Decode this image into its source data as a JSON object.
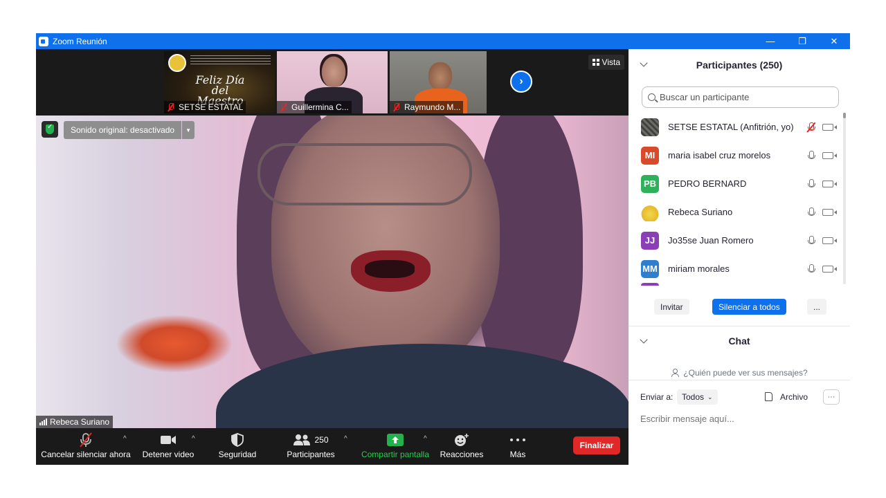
{
  "window": {
    "title": "Zoom Reunión",
    "minimize": "—",
    "restore": "❐",
    "close": "✕"
  },
  "thumbnails": [
    {
      "name": "SETSE ESTATAL",
      "poster_title": "Feliz Día del Maestro"
    },
    {
      "name": "Guillermina C..."
    },
    {
      "name": "Raymundo M..."
    }
  ],
  "view_button": "Vista",
  "main_video": {
    "sound_label": "Sonido original: desactivado",
    "speaker_name": "Rebeca Suriano"
  },
  "toolbar": {
    "mute": "Cancelar silenciar ahora",
    "video": "Detener video",
    "security": "Seguridad",
    "participants": "Participantes",
    "participants_count": "250",
    "share": "Compartir pantalla",
    "reactions": "Reacciones",
    "more": "Más",
    "end": "Finalizar",
    "share_color": "#22b14c",
    "end_color": "#e02828"
  },
  "participants_panel": {
    "title": "Participantes (250)",
    "search_placeholder": "Buscar un participante",
    "items": [
      {
        "initials": "",
        "name": "SETSE ESTATAL (Anfitrión, yo)",
        "color": "#5a5a5a",
        "mic": "off"
      },
      {
        "initials": "MI",
        "name": "maria isabel cruz morelos",
        "color": "#d94a2b",
        "mic": "on"
      },
      {
        "initials": "PB",
        "name": "PEDRO BERNARD",
        "color": "#2fb05a",
        "mic": "on"
      },
      {
        "initials": "",
        "name": "Rebeca Suriano",
        "color": "#f1d348",
        "mic": "on"
      },
      {
        "initials": "JJ",
        "name": "Jo35se Juan Romero",
        "color": "#8b3fb5",
        "mic": "on"
      },
      {
        "initials": "MM",
        "name": "miriam morales",
        "color": "#2f7fd1",
        "mic": "on"
      }
    ],
    "invite": "Invitar",
    "mute_all": "Silenciar a todos",
    "more": "..."
  },
  "chat_panel": {
    "title": "Chat",
    "who_can_see": "¿Quién puede ver sus mensajes?",
    "send_to_label": "Enviar a:",
    "send_to_value": "Todos",
    "file_label": "Archivo",
    "more": "···",
    "input_placeholder": "Escribir mensaje aquí..."
  },
  "colors": {
    "accent": "#0e71eb",
    "title_bar": "#0e71eb",
    "muted_red": "#e02828"
  }
}
